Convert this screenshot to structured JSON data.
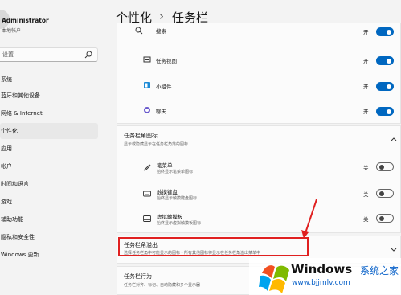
{
  "user": {
    "name": "Administrator",
    "type": "本地帐户"
  },
  "search": {
    "placeholder": "设置"
  },
  "sidebar": {
    "items": [
      {
        "label": "系统"
      },
      {
        "label": "蓝牙和其他设备"
      },
      {
        "label": "网络 & Internet"
      },
      {
        "label": "个性化",
        "active": true
      },
      {
        "label": "应用"
      },
      {
        "label": "帐户"
      },
      {
        "label": "时间和语言"
      },
      {
        "label": "游戏"
      },
      {
        "label": "辅助功能"
      },
      {
        "label": "隐私和安全性"
      },
      {
        "label": "Windows 更新"
      }
    ]
  },
  "header": {
    "parent": "个性化",
    "separator": "›",
    "current": "任务栏"
  },
  "taskbar_items": {
    "rows": [
      {
        "label": "搜索",
        "state": "开",
        "on": true,
        "icon": "search-icon"
      },
      {
        "label": "任务视图",
        "state": "开",
        "on": true,
        "icon": "task-view-icon"
      },
      {
        "label": "小组件",
        "state": "开",
        "on": true,
        "icon": "widgets-icon"
      },
      {
        "label": "聊天",
        "state": "开",
        "on": true,
        "icon": "chat-icon"
      }
    ]
  },
  "corner_icons": {
    "title": "任务栏角图标",
    "subtitle": "显示或隐藏显示在任务栏角落的图标",
    "rows": [
      {
        "label": "笔菜单",
        "sub": "始终显示笔菜单图标",
        "state": "关",
        "on": false,
        "icon": "pen-icon"
      },
      {
        "label": "触摸键盘",
        "sub": "始终显示触摸键盘图标",
        "state": "关",
        "on": false,
        "icon": "keyboard-icon"
      },
      {
        "label": "虚拟触摸板",
        "sub": "始终显示虚拟触摸板图标",
        "state": "关",
        "on": false,
        "icon": "touchpad-icon"
      }
    ]
  },
  "corner_overflow": {
    "title": "任务栏角溢出",
    "subtitle": "选择任务栏角中可能显示的图标 - 所有其他图标将显示在任务栏角溢出菜单中"
  },
  "behaviors": {
    "title": "任务栏行为",
    "subtitle": "任务栏对齐、标记、自动隐藏和多个显示器"
  },
  "watermark": {
    "brand": "Windows",
    "suffix": "系统之家",
    "url": "www.bjjmlv.com"
  },
  "colors": {
    "accent": "#0067c0",
    "highlight": "#e02020"
  }
}
